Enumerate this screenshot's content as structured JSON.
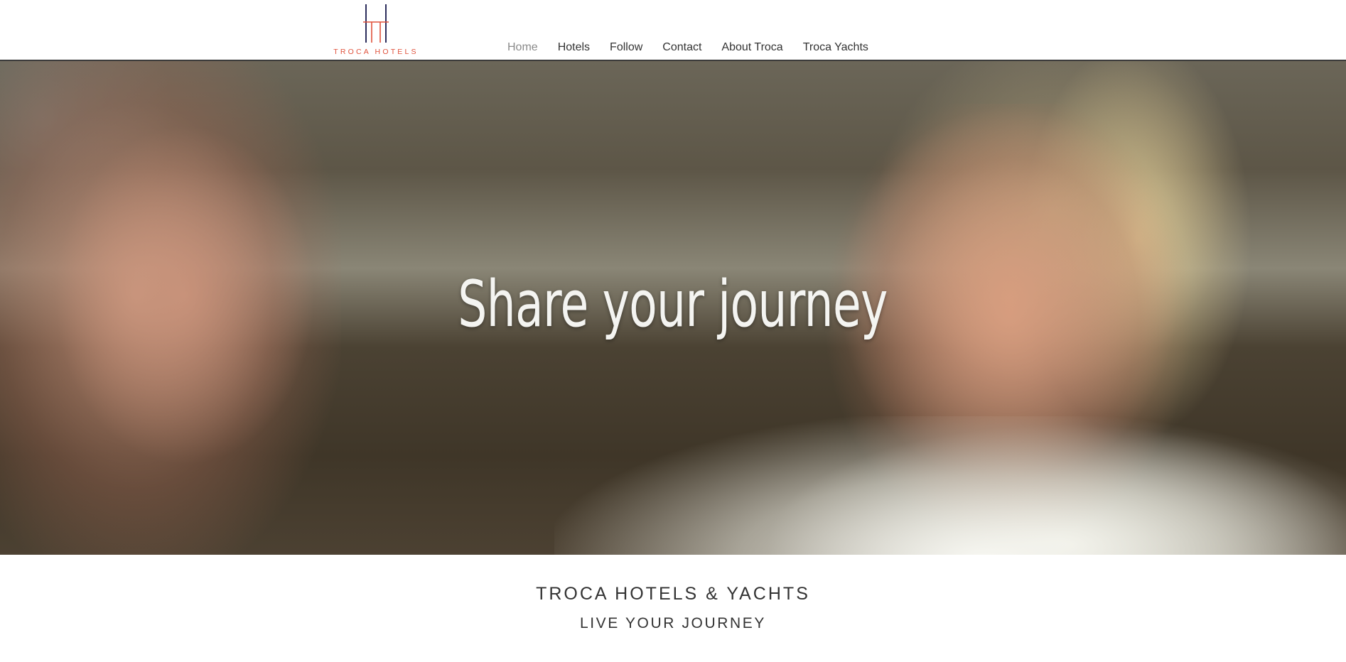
{
  "header": {
    "logo": {
      "icon": "troca-hotels-logo-icon",
      "text": "TROCA HOTELS",
      "colors": {
        "primary": "#2b2d5c",
        "accent": "#e0523c"
      }
    },
    "nav": [
      {
        "label": "Home",
        "active": true
      },
      {
        "label": "Hotels"
      },
      {
        "label": "Follow"
      },
      {
        "label": "Contact"
      },
      {
        "label": "About Troca"
      },
      {
        "label": "Troca Yachts"
      }
    ]
  },
  "hero": {
    "title": "Share your journey"
  },
  "main": {
    "headline": "TROCA HOTELS & YACHTS",
    "subheadline": "LIVE YOUR JOURNEY"
  }
}
